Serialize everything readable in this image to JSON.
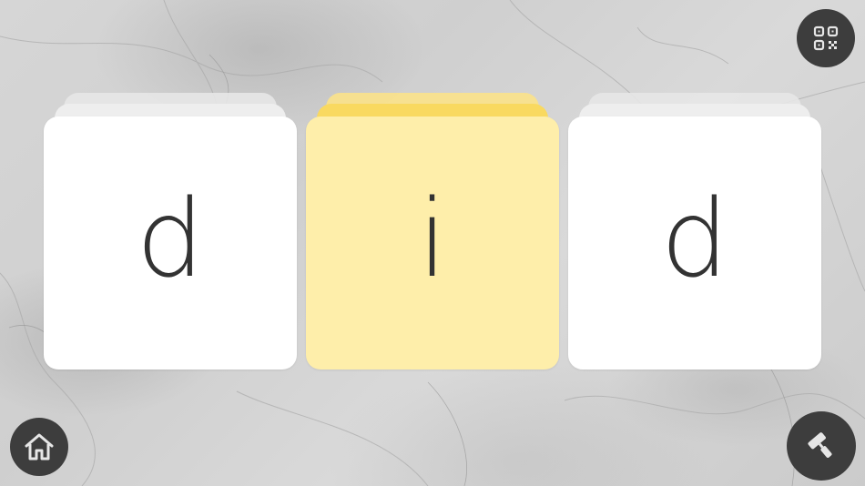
{
  "cards": [
    {
      "letter": "d",
      "style": "white"
    },
    {
      "letter": "i",
      "style": "yellow"
    },
    {
      "letter": "d",
      "style": "white"
    }
  ],
  "icons": {
    "top_right": "qr-code-icon",
    "bottom_left": "home-icon",
    "bottom_right": "paint-roller-icon"
  },
  "colors": {
    "card_white": "#ffffff",
    "card_yellow": "#feeeaa",
    "card_yellow_stack": "#f9d960",
    "letter": "#333333",
    "button_bg": "#3d3d3d",
    "icon": "#e6e6e6"
  }
}
